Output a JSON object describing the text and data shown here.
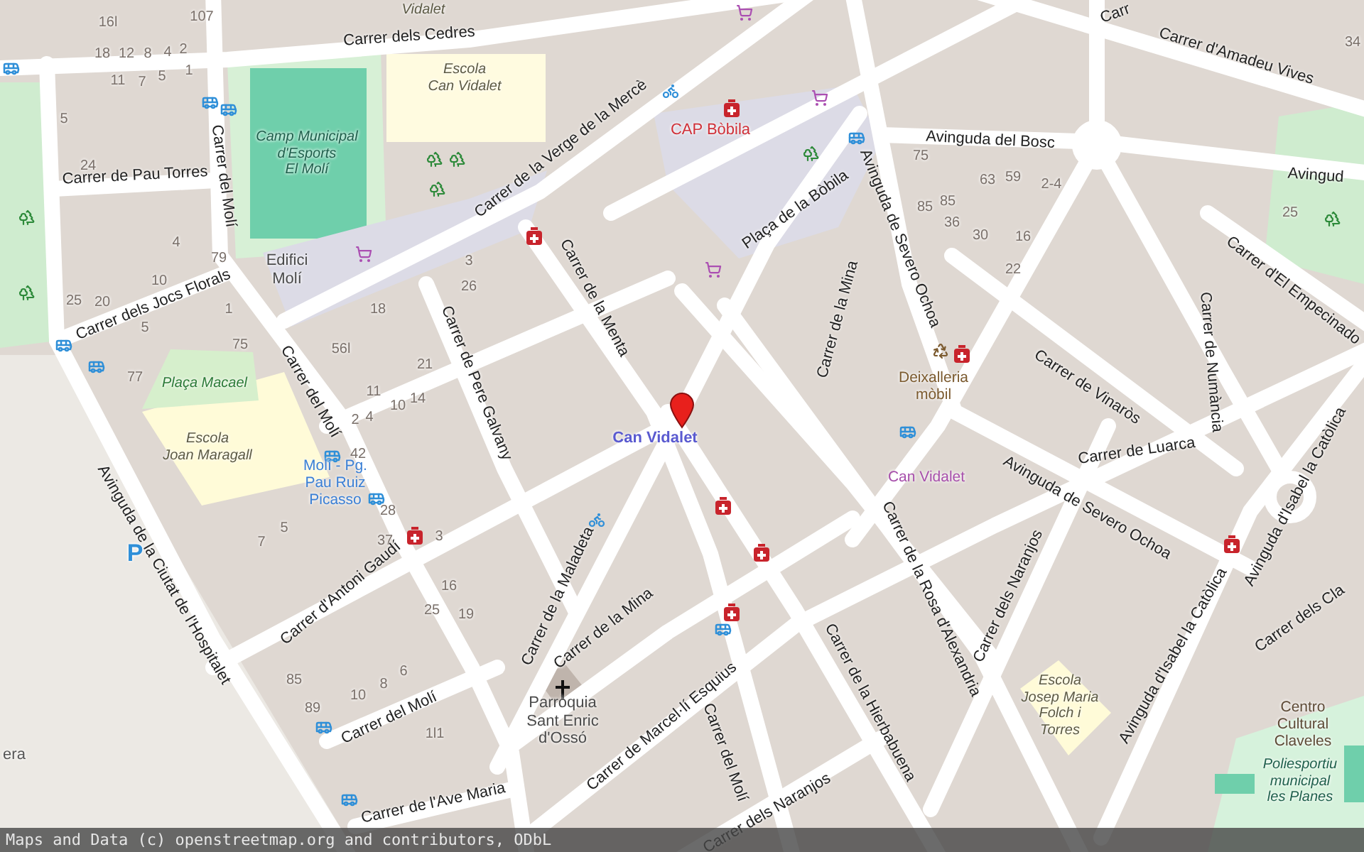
{
  "map": {
    "streets": [
      {
        "name": "Carrer dels Cedres"
      },
      {
        "name": "Carrer d'Amadeu Vives"
      },
      {
        "name": "Carrer de Pau Torres"
      },
      {
        "name": "Carrer del Molí"
      },
      {
        "name": "Carrer de la Verge de la Mercè"
      },
      {
        "name": "Avinguda del Bosc"
      },
      {
        "name": "Avinguda de Severo Ochoa"
      },
      {
        "name": "Plaça de la Bòbila"
      },
      {
        "name": "Carrer dels Jocs Florals"
      },
      {
        "name": "Carrer de la Menta"
      },
      {
        "name": "Carrer de la Mina"
      },
      {
        "name": "Carrer de Pere Galvany"
      },
      {
        "name": "Carrer del Molí"
      },
      {
        "name": "Carrer d'El Empecinado"
      },
      {
        "name": "Carrer de Numància"
      },
      {
        "name": "Carrer de Vinaròs"
      },
      {
        "name": "Carrer de Luarca"
      },
      {
        "name": "Avinguda de Severo Ochoa"
      },
      {
        "name": "Avinguda d'Isabel la Catòlica"
      },
      {
        "name": "Avinguda de la Ciutat de l'Hospitalet"
      },
      {
        "name": "Carrer d'Antoni Gaudí"
      },
      {
        "name": "Carrer de la Maladeta"
      },
      {
        "name": "Carrer de la Mina"
      },
      {
        "name": "Carrer de la Rosa d'Alexandria"
      },
      {
        "name": "Carrer dels Naranjos"
      },
      {
        "name": "Avinguda d'Isabel la Catòlica"
      },
      {
        "name": "Carrer dels Cla"
      },
      {
        "name": "Carrer de Marcel·lí Esquius"
      },
      {
        "name": "Carrer del Molí"
      },
      {
        "name": "Carrer de la Hierbabuena"
      },
      {
        "name": "Carrer del Molí"
      },
      {
        "name": "Carrer de l'Ave Maria"
      },
      {
        "name": "Carrer dels Naranjos"
      },
      {
        "name": "Avingud"
      },
      {
        "name": "Carr"
      }
    ],
    "places": [
      {
        "kind": "school",
        "name": "Vidalet"
      },
      {
        "kind": "school",
        "name": "Escola\nCan Vidalet"
      },
      {
        "kind": "sport",
        "name": "Camp Municipal\nd'Esports\nEl Molí"
      },
      {
        "kind": "medical",
        "name": "CAP Bòbila"
      },
      {
        "kind": "building",
        "name": "Edifici\nMolí"
      },
      {
        "kind": "square",
        "name": "Plaça Macael"
      },
      {
        "kind": "school",
        "name": "Escola\nJoan Maragall"
      },
      {
        "kind": "stop",
        "name": "Molí - Pg.\nPau Ruiz\nPicasso"
      },
      {
        "kind": "station",
        "name": "Can Vidalet"
      },
      {
        "kind": "recycling",
        "name": "Deixalleria\nmòbil"
      },
      {
        "kind": "market",
        "name": "Can Vidalet"
      },
      {
        "kind": "building",
        "name": "Parròquia\nSant Enric\nd'Ossó"
      },
      {
        "kind": "school",
        "name": "Escola\nJosep Maria\nFolch i\nTorres"
      },
      {
        "kind": "culture",
        "name": "Centro\nCultural\nClaveles"
      },
      {
        "kind": "sport",
        "name": "Poliesportiu\nmunicipal\nles Planes"
      },
      {
        "kind": "locality",
        "name": "era"
      },
      {
        "kind": "parking",
        "name": "P"
      }
    ],
    "house_numbers": [
      "107",
      "16l",
      "18",
      "12",
      "8",
      "4",
      "2",
      "11",
      "7",
      "5",
      "1",
      "5",
      "24",
      "4",
      "79",
      "10",
      "25",
      "20",
      "5",
      "1",
      "75",
      "77",
      "18",
      "56l",
      "21",
      "11",
      "10",
      "14",
      "2",
      "4",
      "3",
      "26",
      "42",
      "28",
      "37",
      "3",
      "7",
      "5",
      "16",
      "25",
      "19",
      "85",
      "89",
      "10",
      "8",
      "6",
      "1l1",
      "75",
      "63",
      "59",
      "2-4",
      "85",
      "85",
      "36",
      "30",
      "16",
      "22",
      "25",
      "34"
    ]
  },
  "attribution": "Maps and Data (c) openstreetmap.org and contributors, ODbL"
}
